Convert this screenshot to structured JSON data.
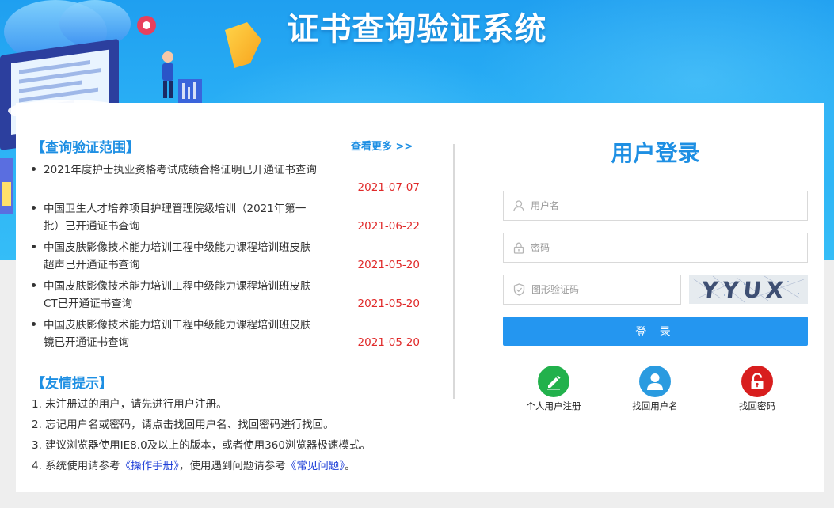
{
  "banner": {
    "title": "证书查询验证系统"
  },
  "left": {
    "scope_title": "【查询验证范围】",
    "more_link": "查看更多 >>",
    "notices": [
      {
        "title": "2021年度护士执业资格考试成绩合格证明已开通证书查询",
        "date": "2021-07-07"
      },
      {
        "title": "中国卫生人才培养项目护理管理院级培训（2021年第一批）已开通证书查询",
        "date": "2021-06-22"
      },
      {
        "title": "中国皮肤影像技术能力培训工程中级能力课程培训班皮肤超声已开通证书查询",
        "date": "2021-05-20"
      },
      {
        "title": "中国皮肤影像技术能力培训工程中级能力课程培训班皮肤CT已开通证书查询",
        "date": "2021-05-20"
      },
      {
        "title": "中国皮肤影像技术能力培训工程中级能力课程培训班皮肤镜已开通证书查询",
        "date": "2021-05-20"
      }
    ],
    "tips_title": "【友情提示】",
    "tips": {
      "t1": "1. 未注册过的用户，请先进行用户注册。",
      "t2": "2. 忘记用户名或密码，请点击找回用户名、找回密码进行找回。",
      "t3": "3. 建议浏览器使用IE8.0及以上的版本，或者使用360浏览器极速模式。",
      "t4_prefix": "4. 系统使用请参考",
      "t4_link1": "《操作手册》",
      "t4_middle": "，使用遇到问题请参考",
      "t4_link2": "《常见问题》",
      "t4_suffix": "。"
    }
  },
  "login": {
    "title": "用户登录",
    "username_placeholder": "用户名",
    "password_placeholder": "密码",
    "captcha_placeholder": "图形验证码",
    "captcha_text": "YYUX",
    "submit_label": "登 录",
    "links": {
      "register": "个人用户注册",
      "find_username": "找回用户名",
      "find_password": "找回密码"
    }
  },
  "colors": {
    "accent": "#1e8fe3",
    "button": "#2496f0",
    "date": "#e02a2a",
    "register_icon": "#22b14c",
    "find_username_icon": "#2a9be0",
    "find_password_icon": "#d81e1e"
  },
  "icons": {
    "username": "user-icon",
    "password": "lock-icon",
    "captcha": "shield-check-icon",
    "register": "pencil-icon",
    "find_username": "person-icon",
    "find_password": "unlock-icon"
  }
}
